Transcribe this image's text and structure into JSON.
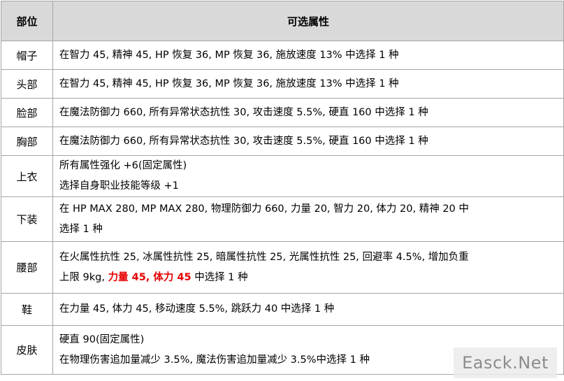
{
  "header": {
    "part": "部位",
    "attrs": "可选属性"
  },
  "rows": [
    {
      "part": "帽子",
      "lines": [
        "在智力 45, 精神 45, HP 恢复 36, MP 恢复 36, 施放速度 13% 中选择 1 种"
      ]
    },
    {
      "part": "头部",
      "lines": [
        "在智力 45, 精神 45, HP 恢复 36, MP 恢复 36, 施放速度 13% 中选择 1 种"
      ]
    },
    {
      "part": "脸部",
      "lines": [
        "在魔法防御力 660, 所有异常状态抗性 30, 攻击速度 5.5%, 硬直 160 中选择 1 种"
      ]
    },
    {
      "part": "胸部",
      "lines": [
        "在魔法防御力 660, 所有异常状态抗性 30, 攻击速度 5.5%, 硬直 160 中选择 1 种"
      ]
    },
    {
      "part": "上衣",
      "lines": [
        "所有属性强化 +6(固定属性)",
        "选择自身职业技能等级 +1"
      ]
    },
    {
      "part": "下装",
      "lines": [
        "在 HP MAX 280, MP MAX 280, 物理防御力 660, 力量 20, 智力 20, 体力 20, 精神 20 中",
        "选择 1 种"
      ]
    },
    {
      "part": "腰部",
      "lines": [
        "在火属性抗性 25, 冰属性抗性 25, 暗属性抗性 25, 光属性抗性 25, 回避率 4.5%, 增加负重"
      ],
      "line2_prefix": "上限 9kg,",
      "line2_highlight": "力量 45, 体力 45",
      "line2_suffix": "中选择 1 种"
    },
    {
      "part": "鞋",
      "lines": [
        "在力量 45, 体力 45, 移动速度 5.5%, 跳跃力 40 中选择 1 种"
      ]
    },
    {
      "part": "皮肤",
      "lines": [
        "硬直 90(固定属性)",
        "在物理伤害追加量减少 3.5%, 魔法伤害追加量减少 3.5%中选择 1 种"
      ]
    }
  ],
  "colors": {
    "header_bg": "#d9d9d9",
    "highlight": "#e60000",
    "border": "#a6a6a6"
  },
  "watermark": "Easck.Net"
}
